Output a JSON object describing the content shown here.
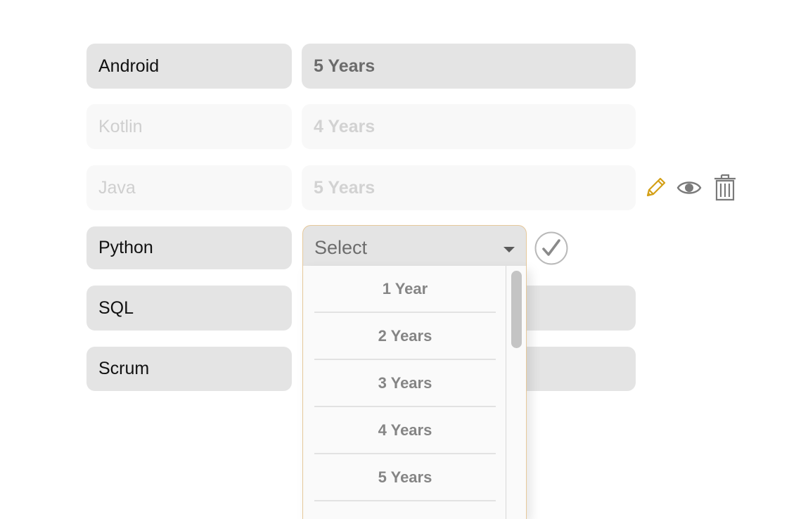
{
  "rows": [
    {
      "skill": "Android",
      "experience": "5 Years"
    },
    {
      "skill": "Kotlin",
      "experience": "4 Years"
    },
    {
      "skill": "Java",
      "experience": "5 Years"
    },
    {
      "skill": "Python"
    },
    {
      "skill": "SQL"
    },
    {
      "skill": "Scrum"
    }
  ],
  "editor": {
    "select_placeholder": "Select",
    "options": [
      "1 Year",
      "2 Years",
      "3 Years",
      "4 Years",
      "5 Years"
    ]
  },
  "icons": {
    "edit": "pencil-icon",
    "view": "eye-icon",
    "delete": "trash-icon",
    "confirm": "checkmark-circle-icon"
  },
  "colors": {
    "accent": "#d4a017",
    "field_bg": "#e4e4e4",
    "dropdown_border": "#e6c89a"
  }
}
